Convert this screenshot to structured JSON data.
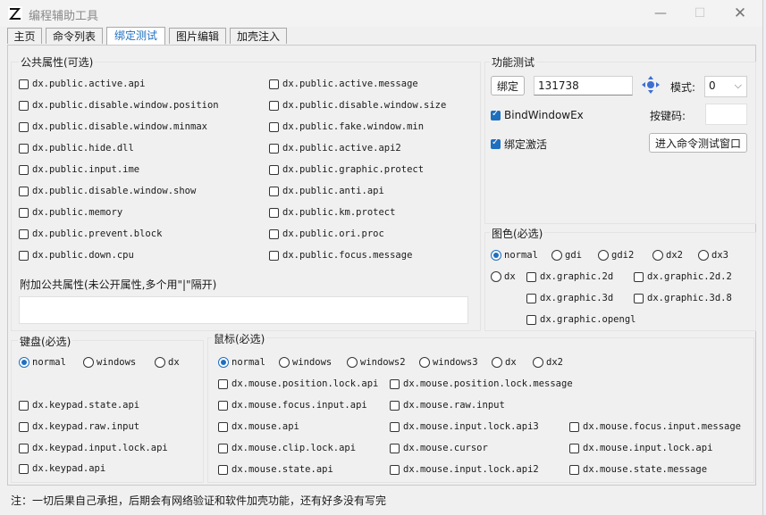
{
  "window": {
    "title": "编程辅助工具",
    "tabs": [
      {
        "label": "主页"
      },
      {
        "label": "命令列表"
      },
      {
        "label": "绑定测试"
      },
      {
        "label": "图片编辑"
      },
      {
        "label": "加壳注入"
      }
    ],
    "active_tab": 2
  },
  "public_attrs": {
    "title": "公共属性(可选)",
    "left": [
      "dx.public.active.api",
      "dx.public.disable.window.position",
      "dx.public.disable.window.minmax",
      "dx.public.hide.dll",
      "dx.public.input.ime",
      "dx.public.disable.window.show",
      "dx.public.memory",
      "dx.public.prevent.block",
      "dx.public.down.cpu"
    ],
    "right": [
      "dx.public.active.message",
      "dx.public.disable.window.size",
      "dx.public.fake.window.min",
      "dx.public.active.api2",
      "dx.public.graphic.protect",
      "dx.public.anti.api",
      "dx.public.km.protect",
      "dx.public.ori.proc",
      "dx.public.focus.message"
    ],
    "extra_label": "附加公共属性(未公开属性,多个用\"|\"隔开)",
    "extra_value": ""
  },
  "func_test": {
    "title": "功能测试",
    "bind_button": "绑定",
    "hwnd_value": "131738",
    "mode_label": "模式:",
    "mode_value": "0",
    "bindex_label": "BindWindowEx",
    "keycode_label": "按键码:",
    "keycode_value": "",
    "activate_label": "绑定激活",
    "enter_button": "进入命令测试窗口"
  },
  "graphic": {
    "title": "图色(必选)",
    "radios": [
      "normal",
      "gdi",
      "gdi2",
      "dx2",
      "dx3",
      "dx"
    ],
    "checks": [
      "dx.graphic.2d",
      "dx.graphic.2d.2",
      "dx.graphic.3d",
      "dx.graphic.3d.8",
      "dx.graphic.opengl"
    ]
  },
  "keyboard": {
    "title": "键盘(必选)",
    "radios": [
      "normal",
      "windows",
      "dx"
    ],
    "checks": [
      "dx.keypad.state.api",
      "dx.keypad.raw.input",
      "dx.keypad.input.lock.api",
      "dx.keypad.api"
    ]
  },
  "mouse": {
    "title": "鼠标(必选)",
    "radios": [
      "normal",
      "windows",
      "windows2",
      "windows3",
      "dx",
      "dx2"
    ],
    "col1": [
      "dx.mouse.position.lock.api",
      "dx.mouse.focus.input.api",
      "dx.mouse.api",
      "dx.mouse.clip.lock.api",
      "dx.mouse.state.api"
    ],
    "col2": [
      "dx.mouse.position.lock.message",
      "dx.mouse.raw.input",
      "dx.mouse.input.lock.api3",
      "dx.mouse.cursor",
      "dx.mouse.input.lock.api2"
    ],
    "col3": [
      "dx.mouse.focus.input.message",
      "dx.mouse.input.lock.api",
      "dx.mouse.state.message"
    ]
  },
  "footer": "注：一切后果自己承担，后期会有网络验证和软件加壳功能，还有好多没有写完",
  "colors": {
    "accent": "#1f6fbf"
  }
}
